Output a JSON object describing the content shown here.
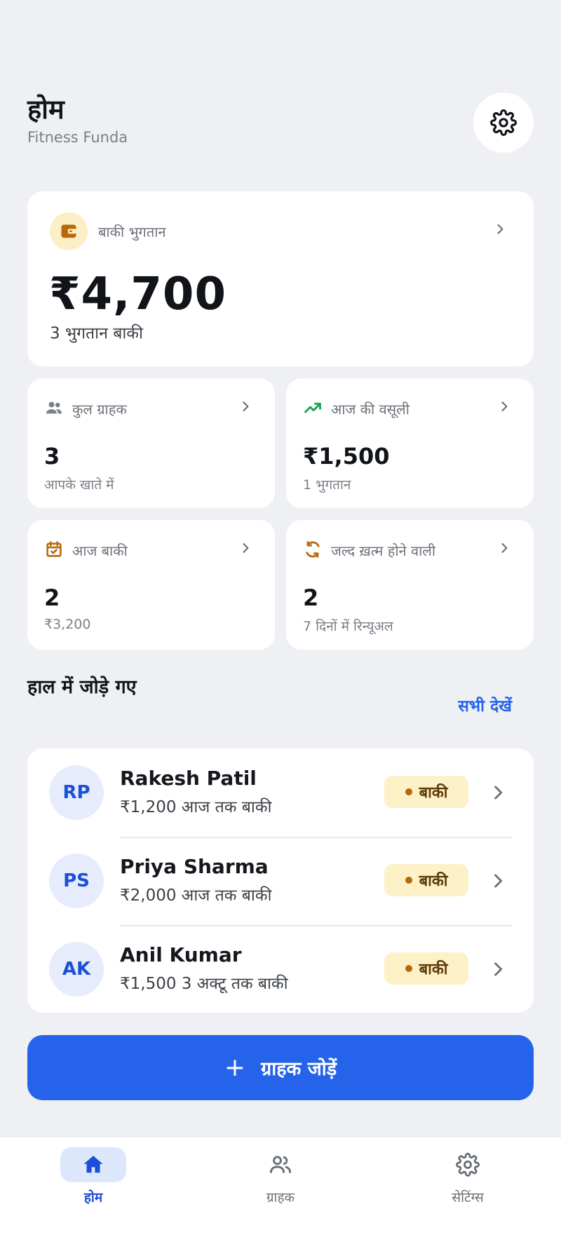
{
  "header": {
    "title": "होम",
    "subtitle": "Fitness Funda"
  },
  "hero": {
    "label": "बाकी भुगतान",
    "amount": "₹4,700",
    "sub": "3 भुगतान बाकी",
    "icon": "wallet-icon"
  },
  "stats": [
    {
      "label": "कुल ग्राहक",
      "value": "3",
      "sub": "आपके खाते में",
      "icon": "people-icon",
      "icon_color": "#7b8088"
    },
    {
      "label": "आज की वसूली",
      "value": "₹1,500",
      "sub": "1 भुगतान",
      "icon": "trending-up-icon",
      "icon_color": "#16a34a"
    },
    {
      "label": "आज बाकी",
      "value": "2",
      "sub": "₹3,200",
      "icon": "calendar-check-icon",
      "icon_color": "#b7690a"
    },
    {
      "label": "जल्द ख़त्म होने वाली",
      "value": "2",
      "sub": "7 दिनों में रिन्यूअल",
      "icon": "refresh-icon",
      "icon_color": "#b7690a"
    }
  ],
  "recent": {
    "title": "हाल में जोड़े गए",
    "see_all": "सभी देखें",
    "customers": [
      {
        "initials": "RP",
        "name": "Rakesh Patil",
        "sub": "₹1,200 आज तक बाकी",
        "status": "बाकी"
      },
      {
        "initials": "PS",
        "name": "Priya Sharma",
        "sub": "₹2,000 आज तक बाकी",
        "status": "बाकी"
      },
      {
        "initials": "AK",
        "name": "Anil Kumar",
        "sub": "₹1,500 3 अक्टू तक बाकी",
        "status": "बाकी"
      }
    ]
  },
  "add_button": {
    "icon": "+",
    "label": "ग्राहक जोड़ें"
  },
  "nav": [
    {
      "label": "होम",
      "icon": "home-icon",
      "active": true
    },
    {
      "label": "ग्राहक",
      "icon": "people-icon",
      "active": false
    },
    {
      "label": "सेटिंग्स",
      "icon": "gear-icon",
      "active": false
    }
  ],
  "colors": {
    "accent": "#2563eb",
    "background": "#eef0f4",
    "pending_badge": "#fdf1c8",
    "pending_dot": "#b7690a"
  }
}
